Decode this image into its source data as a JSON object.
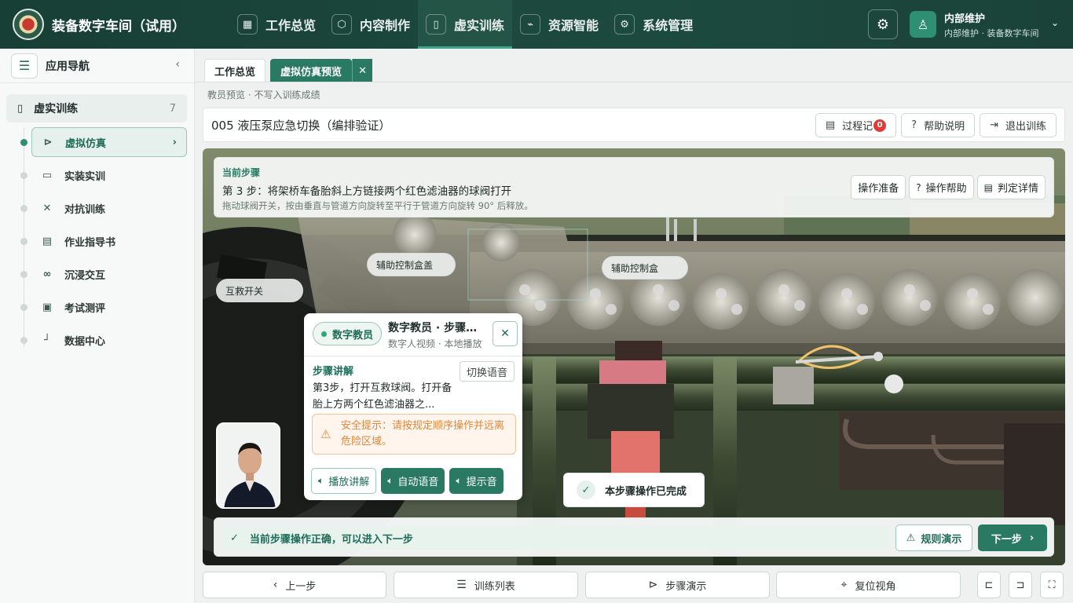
{
  "app": {
    "title": "装备数字车间（试用）"
  },
  "nav": [
    {
      "label": "工作总览",
      "icon": "grid-icon"
    },
    {
      "label": "内容制作",
      "icon": "cube-icon"
    },
    {
      "label": "虚实训练",
      "icon": "book-icon",
      "active": true
    },
    {
      "label": "资源智能",
      "icon": "plug-icon"
    },
    {
      "label": "系统管理",
      "icon": "gear-icon"
    }
  ],
  "user": {
    "name": "内部维护",
    "sub": "内部维护 · 装备数字车间"
  },
  "sidebar": {
    "title": "应用导航",
    "group": {
      "label": "虚实训练",
      "count": "7"
    },
    "items": [
      {
        "label": "虚拟仿真",
        "icon": "play-circle-icon",
        "active": true
      },
      {
        "label": "实装实训",
        "icon": "monitor-icon"
      },
      {
        "label": "对抗训练",
        "icon": "swords-icon"
      },
      {
        "label": "作业指导书",
        "icon": "document-icon"
      },
      {
        "label": "沉浸交互",
        "icon": "vr-headset-icon"
      },
      {
        "label": "考试测评",
        "icon": "clipboard-icon"
      },
      {
        "label": "数据中心",
        "icon": "chart-icon"
      }
    ]
  },
  "tabs": [
    {
      "label": "工作总览"
    },
    {
      "label": "虚拟仿真预览",
      "active": true
    }
  ],
  "breadcrumb": "教员预览 · 不写入训练成绩",
  "page": {
    "title": "005 液压泵应急切换（编排验证）",
    "buttons": {
      "process": "过程记",
      "process_count": "0",
      "help": "帮助说明",
      "exit": "退出训练"
    }
  },
  "step": {
    "label": "当前步骤",
    "main": "第 3 步：将架桥车备胎斜上方链接两个红色滤油器的球阀打开",
    "sub": "拖动球阀开关，按由垂直与管道方向旋转至平行于管道方向旋转 90° 后释放。",
    "buttons": {
      "prep": "操作准备",
      "help": "操作帮助",
      "detail": "判定详情"
    }
  },
  "scene_tags": {
    "tag1": "互救开关",
    "tag2": "辅助控制盒盖",
    "tag3": "辅助控制盒"
  },
  "teacher": {
    "badge": "数字教员",
    "title": "数字教员 · 步骤讲解",
    "sub": "数字人视频 · 本地播放",
    "section": "步骤讲解",
    "switch": "切换语音",
    "body": "第3步，打开互救球阀。打开备胎上方两个红色滤油器之...",
    "warning": "安全提示：请按规定顺序操作并远离危险区域。",
    "buttons": {
      "play": "播放讲解",
      "auto": "自动语音",
      "tone": "提示音"
    }
  },
  "toast": "本步骤操作已完成",
  "status": {
    "message": "当前步骤操作正确，可以进入下一步",
    "rule": "规则演示",
    "next": "下一步"
  },
  "bottom": {
    "prev": "上一步",
    "list": "训练列表",
    "demo": "步骤演示",
    "reset": "复位视角"
  }
}
